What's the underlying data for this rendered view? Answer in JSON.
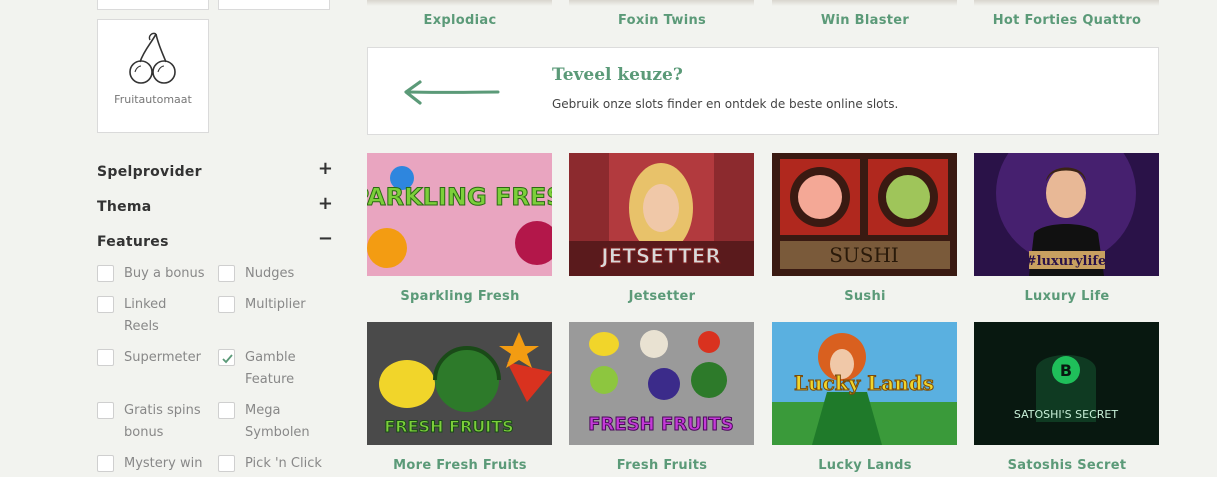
{
  "sidebar": {
    "fruit_label": "Fruitautomaat",
    "filters": [
      {
        "title": "Spelprovider",
        "symbol": "+"
      },
      {
        "title": "Thema",
        "symbol": "+"
      },
      {
        "title": "Features",
        "symbol": "−"
      }
    ],
    "features": [
      {
        "label": "Buy a bonus",
        "checked": false
      },
      {
        "label": "Nudges",
        "checked": false
      },
      {
        "label": "Linked Reels",
        "checked": false
      },
      {
        "label": "Multiplier",
        "checked": false
      },
      {
        "label": "Supermeter",
        "checked": false
      },
      {
        "label": "Gamble Feature",
        "checked": true
      },
      {
        "label": "Gratis spins bonus",
        "checked": false
      },
      {
        "label": "Mega Symbolen",
        "checked": false
      },
      {
        "label": "Mystery win",
        "checked": false
      },
      {
        "label": "Pick 'n Click",
        "checked": false
      }
    ]
  },
  "top_games": [
    "Explodiac",
    "Foxin Twins",
    "Win Blaster",
    "Hot Forties Quattro"
  ],
  "promo": {
    "title": "Teveel keuze?",
    "description": "Gebruik onze slots finder en ontdek de beste online slots."
  },
  "games": [
    {
      "name": "Sparkling Fresh",
      "thumb_text": "SPARKLING FRESH"
    },
    {
      "name": "Jetsetter",
      "thumb_text": "JETSETTER"
    },
    {
      "name": "Sushi",
      "thumb_text": "SUSHI"
    },
    {
      "name": "Luxury Life",
      "thumb_text": "#luxurylife"
    },
    {
      "name": "More Fresh Fruits",
      "thumb_text": "FRESH FRUITS"
    },
    {
      "name": "Fresh Fruits",
      "thumb_text": "FRESH FRUITS"
    },
    {
      "name": "Lucky Lands",
      "thumb_text": "Lucky Lands"
    },
    {
      "name": "Satoshis Secret",
      "thumb_text": "SATOSHI'S SECRET"
    }
  ],
  "colors": {
    "accent": "#5b9a78",
    "background": "#f2f3ef"
  }
}
